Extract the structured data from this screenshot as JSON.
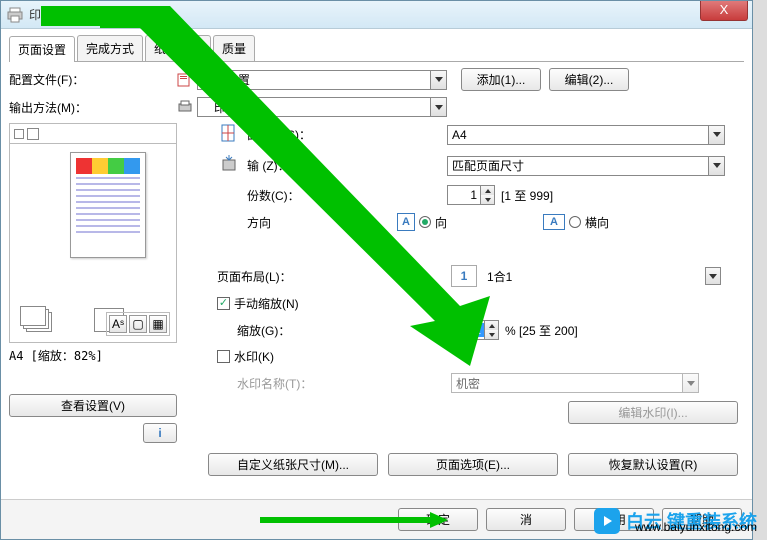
{
  "window": {
    "title": "印首选项"
  },
  "titlebar_buttons": {
    "close": "X"
  },
  "tabs": [
    "页面设置",
    "完成方式",
    "纸张来源",
    "质量"
  ],
  "active_tab_index": 0,
  "profile": {
    "label": "配置文件(F)：",
    "value": "默认设置",
    "add_btn": "添加(1)...",
    "edit_btn": "编辑(2)..."
  },
  "output": {
    "label": "输出方法(M)：",
    "value": "印"
  },
  "preview": {
    "scale_text": "A4 [缩放：82%]"
  },
  "view_settings_btn": "查看设置(V)",
  "page_size": {
    "label": "面尺寸(S)：",
    "value": "A4"
  },
  "output_to": {
    "label": "输         (Z)：",
    "value": "匹配页面尺寸"
  },
  "copies": {
    "label": "份数(C)：",
    "value": "1",
    "range": "[1 至 999]"
  },
  "orientation": {
    "label": "方向",
    "portrait_label": "向",
    "landscape_label": "横向",
    "portrait_checked": true,
    "landscape_checked": false
  },
  "layout": {
    "label": "页面布局(L)：",
    "tile": "1",
    "value": "1合1"
  },
  "manual_scale": {
    "checkbox_label": "手动缩放(N)",
    "checked": true,
    "scale_label": "缩放(G)：",
    "value": "82",
    "suffix": "% [25 至 200]"
  },
  "watermark_opt": {
    "checkbox_label": "水印(K)",
    "checked": false,
    "name_label": "水印名称(T)：",
    "value": "机密",
    "edit_btn": "编辑水印(I)..."
  },
  "bottom_buttons": {
    "custom_paper": "自定义纸张尺寸(M)...",
    "page_options": "页面选项(E)...",
    "restore_defaults": "恢复默认设置(R)"
  },
  "footer_buttons": {
    "ok": "确定",
    "cancel": "消",
    "apply": "应用",
    "help": "帮助"
  },
  "branding": {
    "text": "白云    键重装系统",
    "url": "www.baiyunxitong.com"
  }
}
